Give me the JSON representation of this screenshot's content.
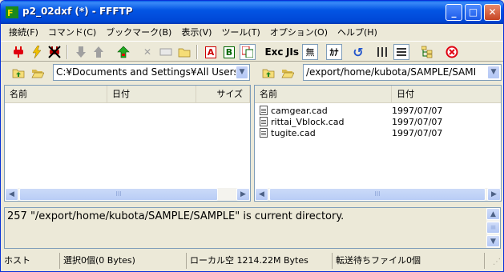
{
  "window": {
    "title": "p2_02dxf (*) - FFFTP"
  },
  "menubar": [
    "接続(F)",
    "コマンド(C)",
    "ブックマーク(B)",
    "表示(V)",
    "ツール(T)",
    "オプション(O)",
    "ヘルプ(H)"
  ],
  "toolbar": {
    "exc_label": "Exc",
    "jis_label": "JIs",
    "none_label": "無",
    "kana_label": "ｶﾅ",
    "a_label": "A",
    "b_label": "B"
  },
  "local": {
    "path": "C:¥Documents and Settings¥All Users¥",
    "columns": [
      "名前",
      "日付",
      "サイズ"
    ]
  },
  "remote": {
    "path": "/export/home/kubota/SAMPLE/SAMI",
    "columns": [
      "名前",
      "日付"
    ],
    "files": [
      {
        "name": "camgear.cad",
        "date": "1997/07/07"
      },
      {
        "name": "rittai_Vblock.cad",
        "date": "1997/07/07"
      },
      {
        "name": "tugite.cad",
        "date": "1997/07/07"
      }
    ]
  },
  "log": {
    "text": "257 \"/export/home/kubota/SAMPLE/SAMPLE\" is current directory."
  },
  "status": {
    "host": "ホスト",
    "selection": "選択0個(0 Bytes)",
    "local_free": "ローカル空 1214.22M Bytes",
    "queue": "転送待ちファイル0個"
  },
  "scroll_thumb_glyph": "III"
}
